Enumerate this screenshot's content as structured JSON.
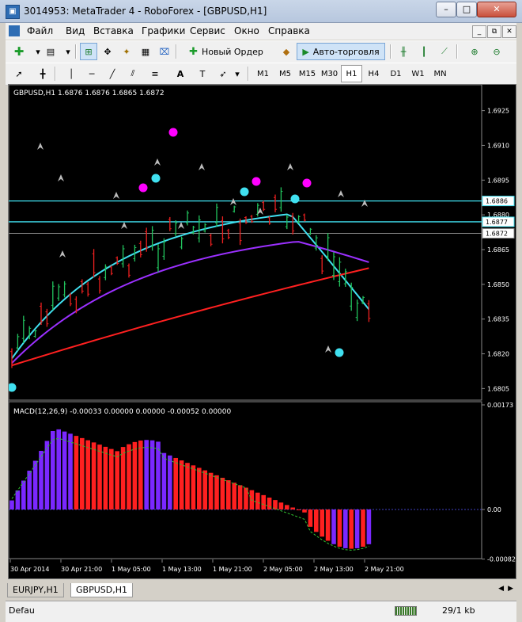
{
  "window": {
    "title": "3014953: MetaTrader 4 - RoboForex - [GBPUSD,H1]"
  },
  "menu": [
    "Файл",
    "Вид",
    "Вставка",
    "Графики",
    "Сервис",
    "Окно",
    "Справка"
  ],
  "toolbar": {
    "new_order": "Новый Ордер",
    "auto_trading": "Авто-торговля"
  },
  "timeframes": [
    "M1",
    "M5",
    "M15",
    "M30",
    "H1",
    "H4",
    "D1",
    "W1",
    "MN"
  ],
  "timeframe_selected": "H1",
  "chart": {
    "header": "GBPUSD,H1  1.6876 1.6876 1.6865 1.6872",
    "price_ticks": [
      "1.6925",
      "1.6910",
      "1.6895",
      "1.6880",
      "1.6865",
      "1.6850",
      "1.6835",
      "1.6820",
      "1.6805"
    ],
    "price_labels": {
      "line1": "1.6886",
      "line2": "1.6877",
      "current": "1.6872"
    },
    "macd_header": "MACD(12,26,9) -0.00033 0.00000 0.00000 -0.00052 0.00000",
    "macd_ticks": [
      "0.00173",
      "0.00",
      "-0.00082"
    ],
    "time_labels": [
      "30 Apr 2014",
      "30 Apr 21:00",
      "1 May 05:00",
      "1 May 13:00",
      "1 May 21:00",
      "2 May 05:00",
      "2 May 13:00",
      "2 May 21:00"
    ]
  },
  "tabs": [
    "EURJPY,H1",
    "GBPUSD,H1"
  ],
  "active_tab": "GBPUSD,H1",
  "status": {
    "profile": "Defau",
    "traffic": "29/1 kb"
  },
  "colors": {
    "bg": "#000000",
    "bull": "#22c55e",
    "bear": "#ef2020",
    "cyan": "#40e0f0",
    "purple": "#9b30ff",
    "red": "#ff2020",
    "magenta": "#ff00ff",
    "macd_red": "#ff2020",
    "macd_blue": "#7a28ff"
  }
}
